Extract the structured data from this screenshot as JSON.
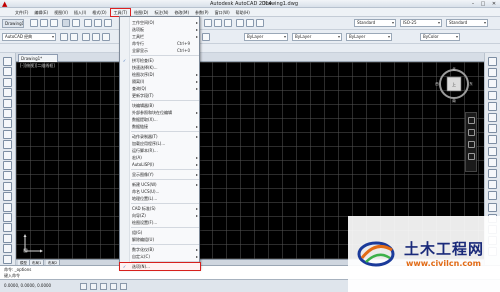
{
  "window": {
    "title": "Autodesk AutoCAD 2014",
    "document": "Drawing1.dwg",
    "min": "–",
    "max": "□",
    "close": "✕"
  },
  "menubar": {
    "items": [
      "文件(F)",
      "编辑(E)",
      "视图(V)",
      "插入(I)",
      "格式(O)",
      "工具(T)",
      "绘图(D)",
      "标注(N)",
      "修改(M)",
      "参数(P)",
      "窗口(W)",
      "帮助(H)"
    ],
    "active_index": 5
  },
  "toolbar": {
    "workspace": "AutoCAD 经典",
    "style_text": "Standard",
    "style_dim": "ISO-25",
    "style_table": "Standard",
    "layer": "ByLayer",
    "linetype": "ByLayer",
    "lineweight": "ByLayer",
    "color": "ByColor"
  },
  "doc_tab": "Drawing1*",
  "view_label": "[-][俯视][二维线框]",
  "layout_tabs": [
    "模型",
    "布局1",
    "布局2"
  ],
  "command": {
    "history": "命令: _options",
    "prompt": "键入命令"
  },
  "status": {
    "coords": "0.0000, 0.0000, 0.0000"
  },
  "tools_menu": {
    "items": [
      {
        "label": "工作空间(O)",
        "shortcut": "",
        "submenu": true,
        "icon": ""
      },
      {
        "label": "选项板",
        "shortcut": "",
        "submenu": true,
        "icon": ""
      },
      {
        "label": "工具栏",
        "shortcut": "",
        "submenu": true,
        "icon": ""
      },
      {
        "label": "命令行",
        "shortcut": "Ctrl+9",
        "submenu": false,
        "icon": ""
      },
      {
        "label": "全屏显示",
        "shortcut": "Ctrl+0",
        "submenu": false,
        "icon": ""
      },
      {
        "label": "拼写检查(E)",
        "shortcut": "",
        "submenu": false,
        "icon": "✓"
      },
      {
        "label": "快速选择(K)...",
        "shortcut": "",
        "submenu": false,
        "icon": ""
      },
      {
        "label": "绘图次序(D)",
        "shortcut": "",
        "submenu": true,
        "icon": ""
      },
      {
        "label": "隔离(I)",
        "shortcut": "",
        "submenu": true,
        "icon": ""
      },
      {
        "label": "查询(Q)",
        "shortcut": "",
        "submenu": true,
        "icon": ""
      },
      {
        "label": "更新字段(T)",
        "shortcut": "",
        "submenu": false,
        "icon": ""
      },
      {
        "label": "块编辑器(B)",
        "shortcut": "",
        "submenu": false,
        "icon": ""
      },
      {
        "label": "外部参照和块在位编辑",
        "shortcut": "",
        "submenu": true,
        "icon": ""
      },
      {
        "label": "数据提取(X)...",
        "shortcut": "",
        "submenu": false,
        "icon": ""
      },
      {
        "label": "数据链接",
        "shortcut": "",
        "submenu": true,
        "icon": ""
      },
      {
        "label": "动作录制器(T)",
        "shortcut": "",
        "submenu": true,
        "icon": ""
      },
      {
        "label": "加载应用程序(L)...",
        "shortcut": "",
        "submenu": false,
        "icon": ""
      },
      {
        "label": "运行脚本(R)...",
        "shortcut": "",
        "submenu": false,
        "icon": ""
      },
      {
        "label": "宏(A)",
        "shortcut": "",
        "submenu": true,
        "icon": ""
      },
      {
        "label": "AutoLISP(I)",
        "shortcut": "",
        "submenu": true,
        "icon": ""
      },
      {
        "label": "显示图像(Y)",
        "shortcut": "",
        "submenu": true,
        "icon": ""
      },
      {
        "label": "新建 UCS(W)",
        "shortcut": "",
        "submenu": true,
        "icon": ""
      },
      {
        "label": "命名 UCS(U)...",
        "shortcut": "",
        "submenu": false,
        "icon": ""
      },
      {
        "label": "地理位置(L)...",
        "shortcut": "",
        "submenu": false,
        "icon": ""
      },
      {
        "label": "CAD 标准(S)",
        "shortcut": "",
        "submenu": true,
        "icon": ""
      },
      {
        "label": "向导(Z)",
        "shortcut": "",
        "submenu": true,
        "icon": ""
      },
      {
        "label": "绘图设置(F)...",
        "shortcut": "",
        "submenu": false,
        "icon": ""
      },
      {
        "label": "组(G)",
        "shortcut": "",
        "submenu": false,
        "icon": ""
      },
      {
        "label": "解除编组(U)",
        "shortcut": "",
        "submenu": false,
        "icon": ""
      },
      {
        "label": "数字化仪(B)",
        "shortcut": "",
        "submenu": true,
        "icon": ""
      },
      {
        "label": "自定义(C)",
        "shortcut": "",
        "submenu": true,
        "icon": ""
      },
      {
        "label": "选项(N)...",
        "shortcut": "",
        "submenu": false,
        "icon": "✓"
      }
    ],
    "highlight_index": 31
  },
  "watermark": {
    "title": "土木工程网",
    "url": "www.civilcn.com"
  }
}
